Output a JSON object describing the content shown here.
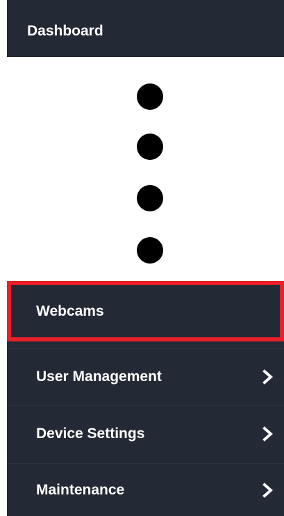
{
  "sidebar": {
    "top_item": {
      "label": "Dashboard"
    },
    "collapsed_indicator": {
      "icon": "vertical-ellipsis-icon",
      "count": 4
    },
    "items": [
      {
        "label": "Webcams",
        "highlighted": true,
        "has_submenu": false
      },
      {
        "label": "User Management",
        "has_submenu": true,
        "icon": "chevron-right-icon"
      },
      {
        "label": "Device Settings",
        "has_submenu": true,
        "icon": "chevron-right-icon"
      },
      {
        "label": "Maintenance",
        "has_submenu": true,
        "icon": "chevron-right-icon"
      }
    ]
  },
  "colors": {
    "sidebar_background": "#242a35",
    "text": "#ffffff",
    "highlight_border": "#e8202a",
    "ellipsis_dots": "#000000"
  }
}
